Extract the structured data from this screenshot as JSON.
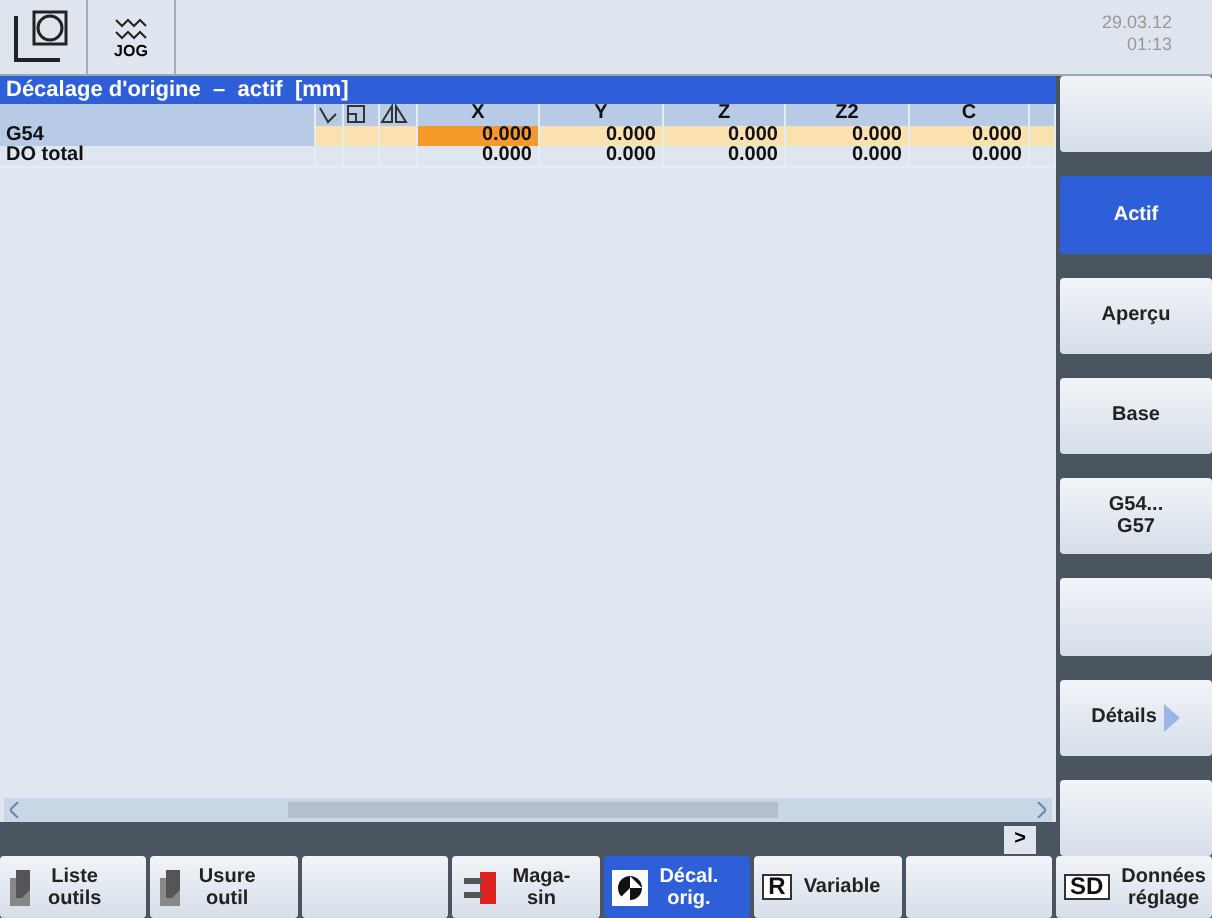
{
  "top_bar": {
    "mode": "JOG",
    "date": "29.03.12",
    "time": "01:13"
  },
  "panel": {
    "title": "Décalage d'origine  –  actif  [mm]",
    "columns": [
      "X",
      "Y",
      "Z",
      "Z2",
      "C"
    ],
    "rows": [
      {
        "label": "G54",
        "selected": true,
        "values": [
          {
            "text": "0.000",
            "selected": true
          },
          {
            "text": "0.000",
            "selected": false
          },
          {
            "text": "0.000",
            "selected": false
          },
          {
            "text": "0.000",
            "selected": false
          },
          {
            "text": "0.000",
            "selected": false
          }
        ]
      },
      {
        "label": "DO total",
        "selected": false,
        "values": [
          {
            "text": "0.000",
            "selected": false
          },
          {
            "text": "0.000",
            "selected": false
          },
          {
            "text": "0.000",
            "selected": false
          },
          {
            "text": "0.000",
            "selected": false
          },
          {
            "text": "0.000",
            "selected": false
          }
        ]
      }
    ],
    "more_button": ">"
  },
  "side_softkeys": [
    {
      "selected": false
    },
    {
      "lines": [
        "Actif"
      ],
      "selected": true
    },
    {
      "lines": [
        "Aperçu"
      ],
      "selected": false
    },
    {
      "lines": [
        "Base"
      ],
      "selected": false
    },
    {
      "lines": [
        "G54...",
        "G57"
      ],
      "selected": false
    },
    {
      "selected": false
    },
    {
      "lines": [
        "Détails"
      ],
      "selected": false,
      "more": true
    },
    {
      "selected": false
    }
  ],
  "bottom_softkeys": [
    {
      "kind": "tool",
      "lines": [
        "Liste",
        "outils"
      ],
      "selected": false
    },
    {
      "kind": "tool",
      "lines": [
        "Usure",
        "outil"
      ],
      "selected": false
    },
    {
      "kind": "empty",
      "selected": false
    },
    {
      "kind": "magazine",
      "lines": [
        "Maga-",
        "sin"
      ],
      "selected": false
    },
    {
      "kind": "offset",
      "lines": [
        "Décal.",
        "orig."
      ],
      "selected": true
    },
    {
      "kind": "letter",
      "badge": "R",
      "lines": [
        "Variable"
      ],
      "selected": false
    },
    {
      "kind": "empty",
      "selected": false
    },
    {
      "kind": "letter",
      "badge": "SD",
      "lines": [
        "Données",
        "réglage"
      ],
      "selected": false
    }
  ]
}
